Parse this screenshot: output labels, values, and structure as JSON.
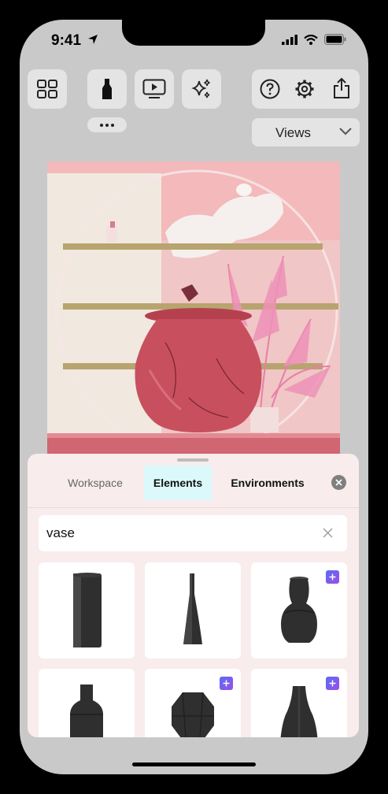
{
  "status_bar": {
    "time": "9:41"
  },
  "toolbar": {
    "grid_icon": "grid-icon",
    "marker_icon": "marker-icon",
    "preview_icon": "play-preview-icon",
    "sparkle_icon": "sparkle-icon",
    "help_icon": "help-icon",
    "settings_icon": "gear-icon",
    "share_icon": "share-icon",
    "views_label": "Views"
  },
  "panel": {
    "tabs": [
      {
        "label": "Workspace",
        "active": false
      },
      {
        "label": "Elements",
        "active": true
      },
      {
        "label": "Environments",
        "active": false
      }
    ],
    "search": {
      "value": "vase"
    },
    "results": [
      {
        "name": "tall-cylinder-vase",
        "premium": false
      },
      {
        "name": "slim-tapered-vase",
        "premium": false
      },
      {
        "name": "bulb-neck-vase",
        "premium": true
      },
      {
        "name": "bottle-vase",
        "premium": false
      },
      {
        "name": "faceted-round-vase",
        "premium": true
      },
      {
        "name": "flared-bottom-vase",
        "premium": true
      }
    ]
  },
  "colors": {
    "accent_tab": "#dbf9fb",
    "scene_background": "#f3b9bb",
    "vase": "#c8505e",
    "premium_badge": "#6b5cf0"
  }
}
